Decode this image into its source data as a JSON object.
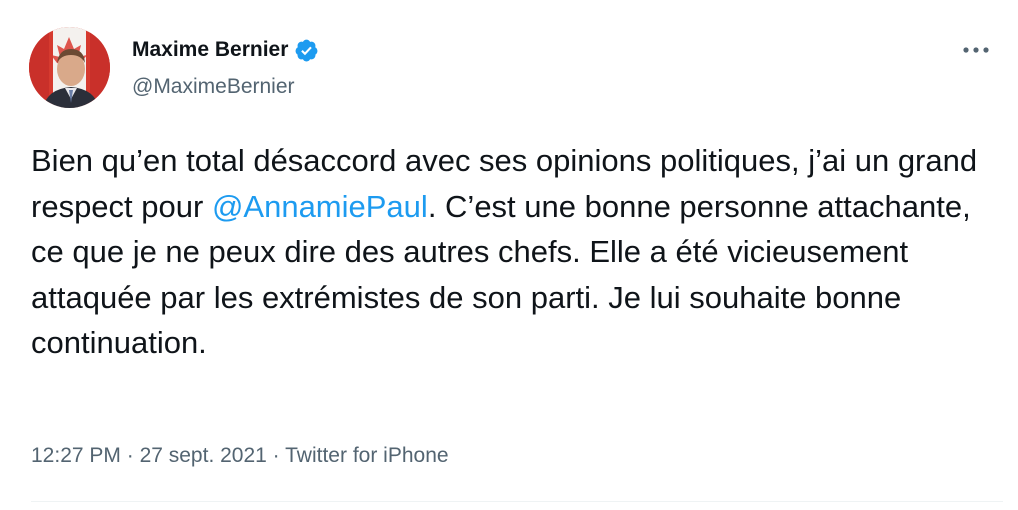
{
  "tweet": {
    "author": {
      "display_name": "Maxime Bernier",
      "handle": "@MaximeBernier",
      "verified": true,
      "avatar_icon": "profile-photo"
    },
    "text_parts": [
      "Bien qu’en total désaccord avec ses opinions politiques, j’ai un grand respect pour ",
      "@AnnamiePaul",
      ". C’est une bonne personne attachante, ce que je ne peux dire des autres chefs. Elle a été vicieusement attaquée par les extrémistes de son parti. Je lui souhaite bonne continuation."
    ],
    "time": "12:27 PM",
    "separator": " · ",
    "date": "27 sept. 2021",
    "source": "Twitter for iPhone",
    "more_icon": "more-horizontal-icon"
  },
  "colors": {
    "accent": "#1d9bf0",
    "text": "#0f1419",
    "secondary": "#536471",
    "divider": "#eff3f4"
  }
}
